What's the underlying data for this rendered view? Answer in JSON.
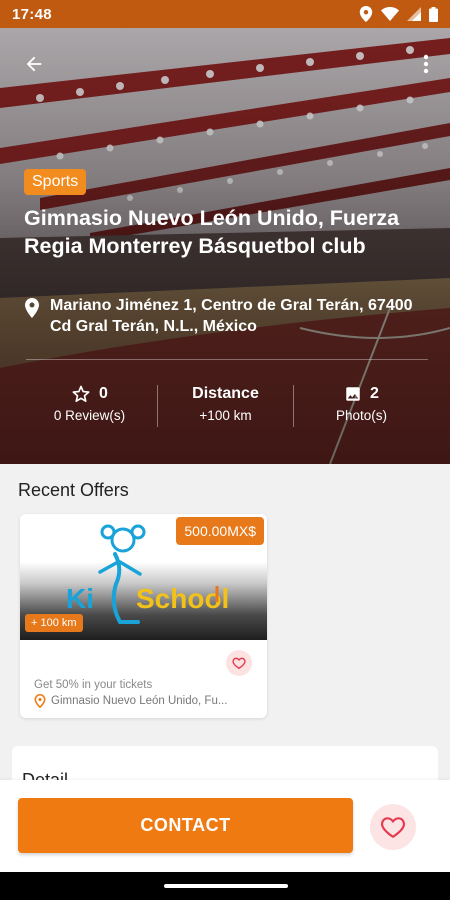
{
  "status_bar": {
    "time": "17:48",
    "icons": [
      "location-icon",
      "wifi-icon",
      "signal-icon",
      "battery-icon"
    ]
  },
  "hero": {
    "category": "Sports",
    "title": "Gimnasio Nuevo León Unido, Fuerza Regia Monterrey Básquetbol club",
    "address": "Mariano Jiménez 1, Centro de Gral Terán, 67400 Cd Gral Terán, N.L., México",
    "stats": {
      "reviews_count": "0",
      "reviews_label": "0 Review(s)",
      "distance_title": "Distance",
      "distance_value": "+100 km",
      "photos_count": "2",
      "photos_label": "Photo(s)"
    }
  },
  "offers": {
    "section_title": "Recent Offers",
    "items": [
      {
        "price": "500.00MX$",
        "distance": "+ 100 km",
        "logo_text": "KidSchool",
        "description": "Get 50% in your tickets",
        "location": "Gimnasio Nuevo León Unido, Fu..."
      }
    ]
  },
  "detail": {
    "title": "Detail"
  },
  "actions": {
    "contact_label": "CONTACT"
  },
  "colors": {
    "status_bar": "#bf5a10",
    "accent": "#f07a12",
    "badge": "#e8791a",
    "heart": "#e53950",
    "heart_bg": "#fde4e4"
  }
}
